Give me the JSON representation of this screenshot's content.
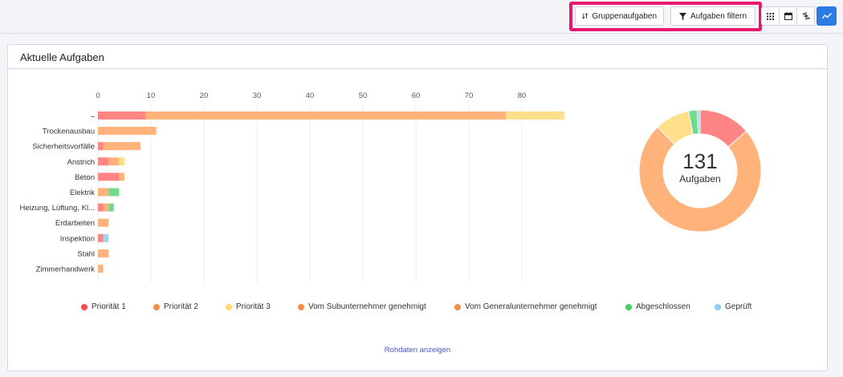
{
  "toolbar": {
    "group_label": "Gruppenaufgaben",
    "filter_label": "Aufgaben filtern",
    "icons": [
      "grid-icon",
      "calendar-icon",
      "gantt-icon",
      "chart-line-icon"
    ]
  },
  "panel": {
    "title": "Aktuelle Aufgaben",
    "raw_data_link": "Rohdaten anzeigen"
  },
  "donut": {
    "total": "131",
    "label": "Aufgaben"
  },
  "colors": {
    "p1": "#ff8585",
    "p2": "#ffb27a",
    "p3": "#ffe08a",
    "sub": "#ffb27a",
    "gen": "#ffb27a",
    "done": "#6fdc8c",
    "checked": "#a3d4f5",
    "legend_p1": "#f24c4c",
    "legend_p2": "#f58d45",
    "legend_p3": "#ffd966",
    "legend_sub": "#f58d45",
    "legend_gen": "#f58d45",
    "legend_done": "#3ecf67",
    "legend_checked": "#8fcdf5"
  },
  "chart_data": {
    "type": "bar",
    "orientation": "horizontal",
    "stacked": true,
    "xlim": [
      0,
      88
    ],
    "xticks": [
      0,
      10,
      20,
      30,
      40,
      50,
      60,
      70,
      80
    ],
    "grid": true,
    "legend_position": "bottom",
    "categories": [
      "–",
      "Trockenausbau",
      "Sicherheitsvorfälle",
      "Anstrich",
      "Beton",
      "Elektrik",
      "Heizung, Lüftung, Kl...",
      "Erdarbeiten",
      "Inspektion",
      "Stahl",
      "Zimmerhandwerk"
    ],
    "series": [
      {
        "name": "Priorität 1",
        "key": "p1",
        "values": [
          9,
          0,
          1,
          2,
          4,
          0,
          1,
          0,
          1,
          0,
          0
        ]
      },
      {
        "name": "Priorität 2",
        "key": "p2",
        "values": [
          68,
          11,
          7,
          2,
          1,
          2,
          1,
          2,
          0,
          2,
          1
        ]
      },
      {
        "name": "Priorität 3",
        "key": "p3",
        "values": [
          11,
          0,
          0,
          1,
          0,
          0,
          0,
          0,
          0,
          0,
          0
        ]
      },
      {
        "name": "Vom Subunternehmer genehmigt",
        "key": "sub",
        "values": [
          0,
          0,
          0,
          0,
          0,
          0,
          0,
          0,
          0,
          0,
          0
        ]
      },
      {
        "name": "Vom Generalunternehmer genehmigt",
        "key": "gen",
        "values": [
          0,
          0,
          0,
          0,
          0,
          0,
          0,
          0,
          0,
          0,
          0
        ]
      },
      {
        "name": "Abgeschlossen",
        "key": "done",
        "values": [
          0,
          0,
          0,
          0,
          0,
          2,
          1,
          0,
          0,
          0,
          0
        ]
      },
      {
        "name": "Geprüft",
        "key": "checked",
        "values": [
          0,
          0,
          0,
          0,
          0,
          0,
          0,
          0,
          1,
          0,
          0
        ]
      }
    ],
    "donut": {
      "type": "pie",
      "slices": [
        {
          "name": "Priorität 1",
          "key": "p1",
          "value": 18
        },
        {
          "name": "Priorität 2",
          "key": "p2",
          "value": 97
        },
        {
          "name": "Priorität 3",
          "key": "p3",
          "value": 12
        },
        {
          "name": "Abgeschlossen",
          "key": "done",
          "value": 3
        },
        {
          "name": "Geprüft",
          "key": "checked",
          "value": 1
        }
      ]
    }
  }
}
